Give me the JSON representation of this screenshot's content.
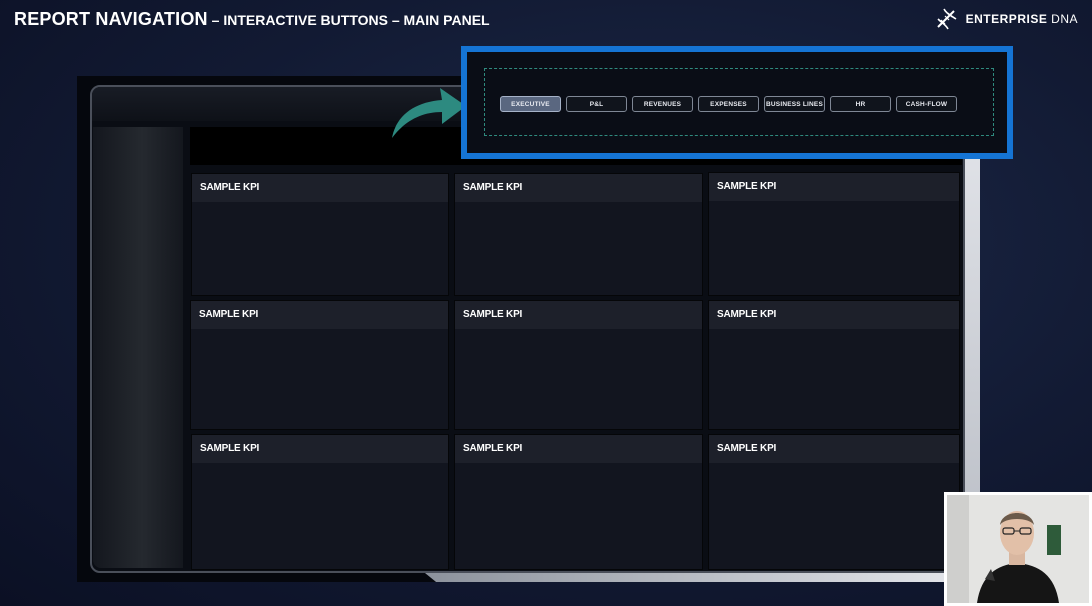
{
  "header": {
    "title_main": "REPORT NAVIGATION",
    "title_sub": " – INTERACTIVE BUTTONS – MAIN PANEL",
    "brand_name_bold": "ENTERPRISE",
    "brand_name_light": " DNA",
    "brand_icon": "dna-helix-icon"
  },
  "nav": {
    "buttons": [
      {
        "label": "EXECUTIVE",
        "active": true
      },
      {
        "label": "P&L",
        "active": false
      },
      {
        "label": "REVENUES",
        "active": false
      },
      {
        "label": "EXPENSES",
        "active": false
      },
      {
        "label": "BUSINESS LINES",
        "active": false
      },
      {
        "label": "HR",
        "active": false
      },
      {
        "label": "CASH-FLOW",
        "active": false
      }
    ]
  },
  "kpi_cards": [
    {
      "label": "SAMPLE KPI"
    },
    {
      "label": "SAMPLE KPI"
    },
    {
      "label": "SAMPLE KPI"
    },
    {
      "label": "SAMPLE KPI"
    },
    {
      "label": "SAMPLE KPI"
    },
    {
      "label": "SAMPLE KPI"
    },
    {
      "label": "SAMPLE KPI"
    },
    {
      "label": "SAMPLE KPI"
    },
    {
      "label": "SAMPLE KPI"
    }
  ],
  "colors": {
    "highlight_border": "#1574d4",
    "arrow": "#2d8a80",
    "dashed_outline": "#2f8a7e",
    "active_button": "#5a6780"
  },
  "icons": {
    "arrow": "curved-arrow-icon"
  }
}
